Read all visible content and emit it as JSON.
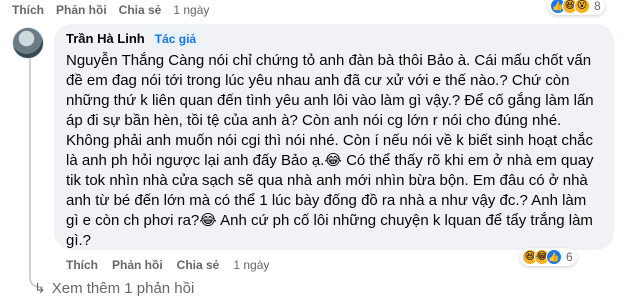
{
  "top_comment_actions": {
    "like": "Thích",
    "reply": "Phản hồi",
    "share": "Chia sẻ",
    "time": "1 ngày"
  },
  "top_reactions": {
    "count": "8",
    "emojis": [
      "like-icon",
      "haha-icon",
      "wow-icon"
    ]
  },
  "reply": {
    "author": "Trần Hà Linh",
    "badge": "Tác giả",
    "text": "Nguyễn Thắng Càng nói chỉ chứng tỏ anh đàn bà thôi Bảo à. Cái mấu chốt vấn đề em đag nói tới trong lúc yêu nhau anh đã cư xử với e thế nào.? Chứ còn những thứ k liên quan đến tình yêu anh lôi vào làm gì vậy.? Để cố gắng làm lấn áp đi sự bần hèn, tồi tệ của anh à? Còn anh nói cg lớn r nói cho đúng nhé. Không phải anh muốn nói cgi thì nói nhé. Còn í nếu nói về k biết sinh hoạt chắc là anh ph hỏi ngược lại anh đấy Bảo ạ.😂 Có thể thấy rõ khi em ở nhà em quay tik tok nhìn nhà cửa sạch sẽ qua nhà anh mới nhìn bừa bộn. Em đâu có ở nhà anh từ bé đến lớn mà có thể 1 lúc bày đống đồ ra nhà a như vậy đc.? Anh làm gì e còn ch phơi ra?😂 Anh cứ ph cố lôi những chuyện k lquan để tẩy trắng làm gì.?",
    "actions": {
      "like": "Thích",
      "reply": "Phản hồi",
      "share": "Chia sẻ",
      "time": "1 ngày"
    },
    "reactions": {
      "count": "6",
      "emojis": [
        "haha-icon",
        "haha-icon",
        "like-icon"
      ]
    }
  },
  "more_replies": "Xem thêm 1 phản hồi"
}
